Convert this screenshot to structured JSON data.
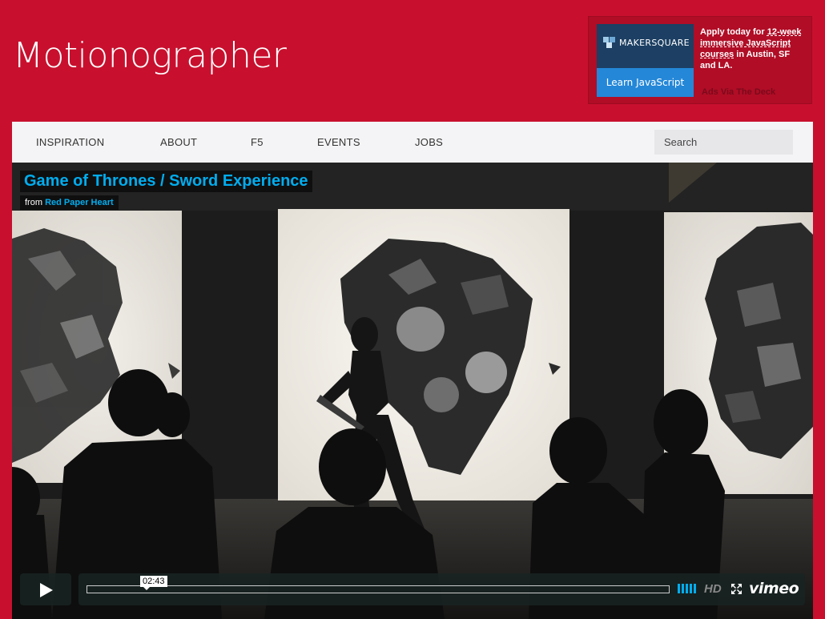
{
  "site": {
    "title": "Motionographer"
  },
  "ad": {
    "brand": "MAKERSQUARE",
    "cta": "Learn JavaScript",
    "copy_prefix": "Apply today for ",
    "copy_link": "12-week immersive JavaScript courses",
    "copy_suffix": " in Austin, SF and LA.",
    "via": "Ads Via The Deck"
  },
  "nav": {
    "items": [
      "INSPIRATION",
      "ABOUT",
      "F5",
      "EVENTS",
      "JOBS"
    ],
    "search_placeholder": "Search"
  },
  "video": {
    "title": "Game of Thrones / Sword Experience",
    "from_label": "from",
    "author": "Red Paper Heart",
    "duration": "02:43",
    "hd_label": "HD",
    "player_brand": "vimeo"
  },
  "colors": {
    "brand_red": "#c8102e",
    "vimeo_blue": "#00adef"
  }
}
